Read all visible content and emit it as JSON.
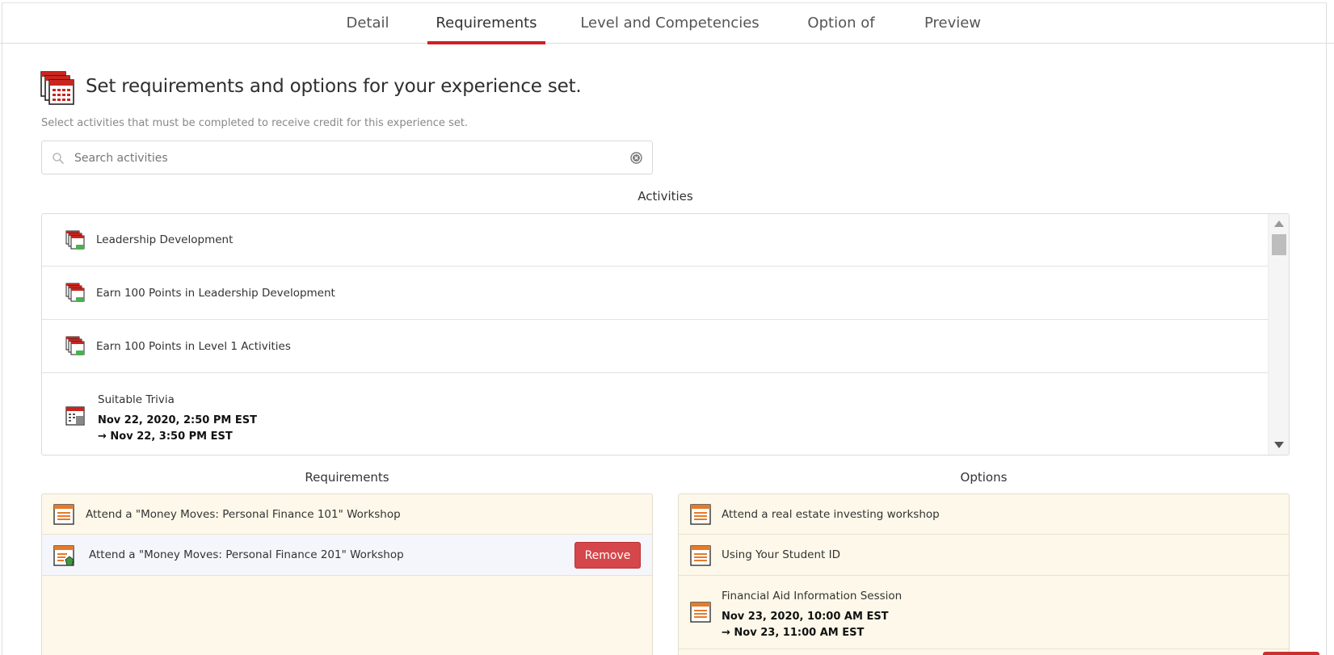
{
  "tabs": [
    {
      "label": "Detail"
    },
    {
      "label": "Requirements"
    },
    {
      "label": "Level and Competencies"
    },
    {
      "label": "Option of"
    },
    {
      "label": "Preview"
    }
  ],
  "header": {
    "title": "Set requirements and options for your experience set.",
    "subtitle": "Select activities that must be completed to receive credit for this experience set."
  },
  "search": {
    "placeholder": "Search activities",
    "value": ""
  },
  "activities": {
    "heading": "Activities",
    "items": [
      {
        "title": "Leadership Development",
        "icon": "experience-set-icon"
      },
      {
        "title": "Earn 100 Points in Leadership Development",
        "icon": "experience-set-icon"
      },
      {
        "title": "Earn 100 Points in Level 1 Activities",
        "icon": "experience-set-icon"
      },
      {
        "title": "Suitable Trivia",
        "icon": "event-icon",
        "start": "Nov 22, 2020, 2:50 PM EST",
        "end": "→ Nov 22, 3:50 PM EST"
      }
    ]
  },
  "requirements": {
    "heading": "Requirements",
    "items": [
      {
        "title": "Attend a \"Money Moves: Personal Finance 101\" Workshop"
      },
      {
        "title": "Attend a \"Money Moves: Personal Finance 201\" Workshop",
        "action": "Remove"
      }
    ]
  },
  "options": {
    "heading": "Options",
    "items": [
      {
        "title": "Attend a real estate investing workshop"
      },
      {
        "title": "Using Your Student ID"
      },
      {
        "title": "Financial Aid Information Session",
        "start": "Nov 23, 2020, 10:00 AM EST",
        "end": "→ Nov 23, 11:00 AM EST"
      }
    ]
  },
  "colors": {
    "accent": "#d11f24",
    "remove_button": "#d5474a",
    "panel_background": "#fdf8e9"
  }
}
